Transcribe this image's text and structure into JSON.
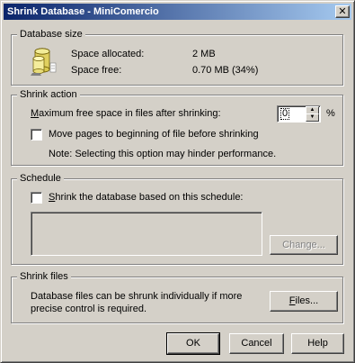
{
  "window": {
    "title": "Shrink Database - MiniComercio",
    "close_glyph": "✕"
  },
  "database_size": {
    "legend": "Database size",
    "icon": "database-icon",
    "allocated_label": "Space allocated:",
    "allocated_value": "2 MB",
    "free_label": "Space free:",
    "free_value": "0.70 MB (34%)"
  },
  "shrink_action": {
    "legend": "Shrink action",
    "max_free_label_key": "M",
    "max_free_label_rest": "aximum free space in files after shrinking:",
    "max_free_value": "0",
    "percent_sign": "%",
    "move_pages_label": "Move pages to beginning of file before shrinking",
    "move_pages_checked": false,
    "note": "Note: Selecting this option may hinder performance."
  },
  "schedule": {
    "legend": "Schedule",
    "shrink_schedule_key": "S",
    "shrink_schedule_rest": "hrink the database based on this schedule:",
    "shrink_schedule_checked": false,
    "schedule_text": "",
    "change_button": "Change..."
  },
  "shrink_files": {
    "legend": "Shrink files",
    "description_line1": "Database files can be shrunk individually if more",
    "description_line2": "precise control is required.",
    "files_button_key": "F",
    "files_button_rest": "iles..."
  },
  "footer": {
    "ok_label": "OK",
    "cancel_label": "Cancel",
    "help_label": "Help"
  },
  "colors": {
    "face": "#d4d0c8",
    "title_start": "#0a246a",
    "title_end": "#a6caf0"
  }
}
